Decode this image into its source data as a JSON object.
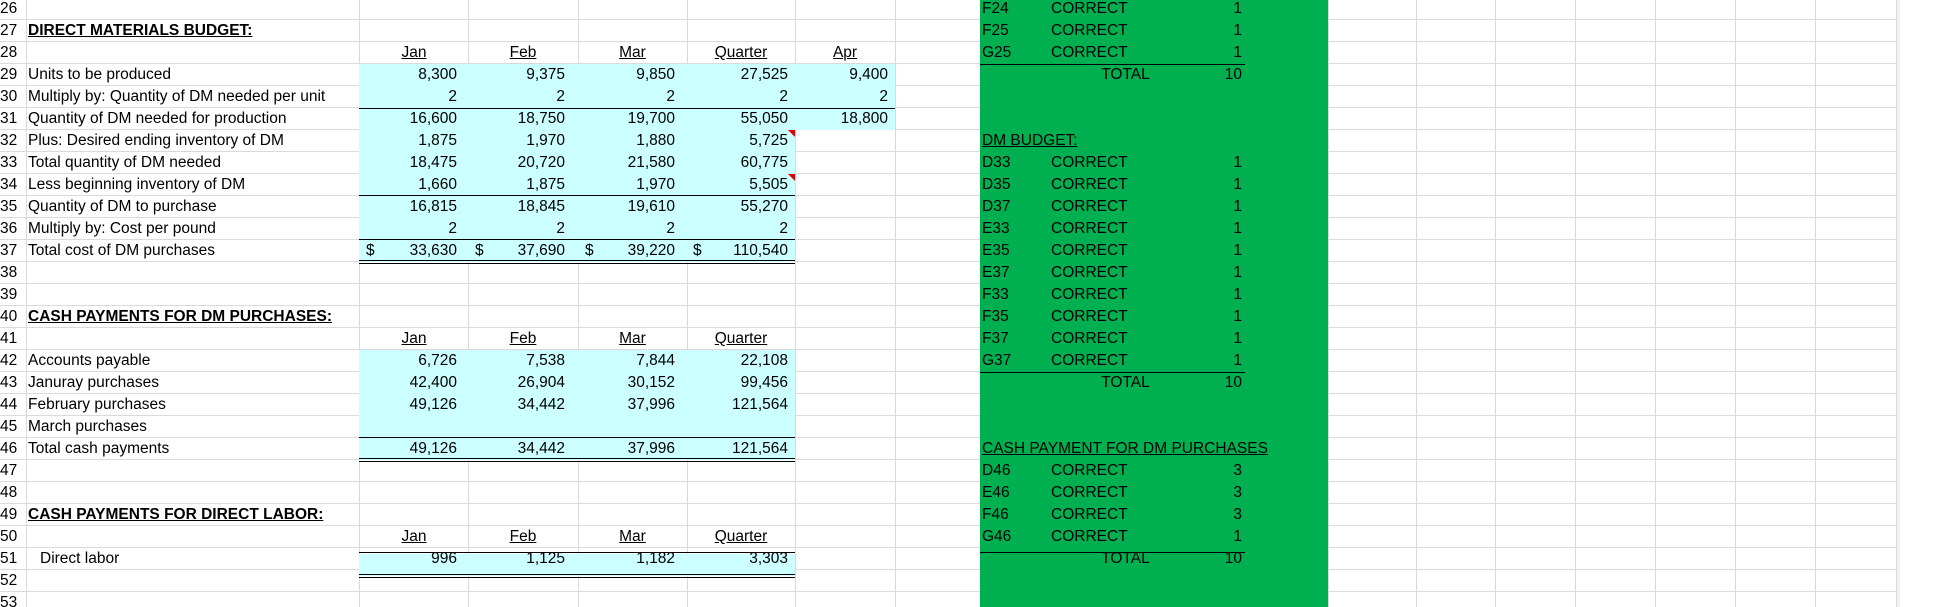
{
  "colors": {
    "cyan_fill": "#ccffff",
    "green_fill": "#00b050",
    "grid": "#dadada"
  },
  "row_numbers": [
    "26",
    "27",
    "28",
    "29",
    "30",
    "31",
    "32",
    "33",
    "34",
    "35",
    "36",
    "37",
    "38",
    "39",
    "40",
    "41",
    "42",
    "43",
    "44",
    "45",
    "46",
    "47",
    "48",
    "49",
    "50",
    "51",
    "52",
    "53"
  ],
  "dm_budget": {
    "title": "DIRECT MATERIALS BUDGET:",
    "headers": [
      "Jan",
      "Feb",
      "Mar",
      "Quarter",
      "Apr"
    ],
    "rows": [
      {
        "label": "Units to be produced",
        "v": [
          "8,300",
          "9,375",
          "9,850",
          "27,525",
          "9,400"
        ]
      },
      {
        "label": "Multiply by: Quantity of DM needed per unit",
        "v": [
          "2",
          "2",
          "2",
          "2",
          "2"
        ]
      },
      {
        "label": "Quantity of DM needed for production",
        "v": [
          "16,600",
          "18,750",
          "19,700",
          "55,050",
          "18,800"
        ]
      },
      {
        "label": "Plus: Desired ending inventory of DM",
        "v": [
          "1,875",
          "1,970",
          "1,880",
          "5,725",
          ""
        ]
      },
      {
        "label": "Total quantity of DM needed",
        "v": [
          "18,475",
          "20,720",
          "21,580",
          "60,775",
          ""
        ]
      },
      {
        "label": "Less beginning inventory of DM",
        "v": [
          "1,660",
          "1,875",
          "1,970",
          "5,505",
          ""
        ]
      },
      {
        "label": "Quantity of DM to purchase",
        "v": [
          "16,815",
          "18,845",
          "19,610",
          "55,270",
          ""
        ]
      },
      {
        "label": "Multiply by: Cost per pound",
        "v": [
          "2",
          "2",
          "2",
          "2",
          ""
        ]
      },
      {
        "label": "Total cost of DM purchases",
        "v": [
          "33,630",
          "37,690",
          "39,220",
          "110,540",
          ""
        ]
      }
    ],
    "currency": "$"
  },
  "cash_dm": {
    "title": "CASH PAYMENTS FOR DM PURCHASES:",
    "headers": [
      "Jan",
      "Feb",
      "Mar",
      "Quarter"
    ],
    "rows": [
      {
        "label": "Accounts payable",
        "v": [
          "6,726",
          "7,538",
          "7,844",
          "22,108"
        ]
      },
      {
        "label": "Januray purchases",
        "v": [
          "42,400",
          "26,904",
          "30,152",
          "99,456"
        ]
      },
      {
        "label": "February purchases",
        "v": [
          "49,126",
          "34,442",
          "37,996",
          "121,564"
        ]
      },
      {
        "label": "March purchases",
        "v": [
          "",
          "",
          "",
          ""
        ]
      },
      {
        "label": "Total cash payments",
        "v": [
          "49,126",
          "34,442",
          "37,996",
          "121,564"
        ]
      }
    ]
  },
  "cash_dl": {
    "title": "CASH PAYMENTS FOR DIRECT LABOR:",
    "headers": [
      "Jan",
      "Feb",
      "Mar",
      "Quarter"
    ],
    "rows": [
      {
        "label": "Direct labor",
        "v": [
          "996",
          "1,125",
          "1,182",
          "3,303"
        ]
      }
    ]
  },
  "grader": {
    "top": [
      {
        "cell": "F24",
        "status": "CORRECT",
        "score": "1"
      },
      {
        "cell": "F25",
        "status": "CORRECT",
        "score": "1"
      },
      {
        "cell": "G25",
        "status": "CORRECT",
        "score": "1"
      }
    ],
    "top_total": {
      "label": "TOTAL",
      "score": "10"
    },
    "dm_title": "DM BUDGET:",
    "dm": [
      {
        "cell": "D33",
        "status": "CORRECT",
        "score": "1"
      },
      {
        "cell": "D35",
        "status": "CORRECT",
        "score": "1"
      },
      {
        "cell": "D37",
        "status": "CORRECT",
        "score": "1"
      },
      {
        "cell": "E33",
        "status": "CORRECT",
        "score": "1"
      },
      {
        "cell": "E35",
        "status": "CORRECT",
        "score": "1"
      },
      {
        "cell": "E37",
        "status": "CORRECT",
        "score": "1"
      },
      {
        "cell": "F33",
        "status": "CORRECT",
        "score": "1"
      },
      {
        "cell": "F35",
        "status": "CORRECT",
        "score": "1"
      },
      {
        "cell": "F37",
        "status": "CORRECT",
        "score": "1"
      },
      {
        "cell": "G37",
        "status": "CORRECT",
        "score": "1"
      }
    ],
    "dm_total": {
      "label": "TOTAL",
      "score": "10"
    },
    "cash_title": "CASH PAYMENT FOR DM PURCHASES",
    "cash": [
      {
        "cell": "D46",
        "status": "CORRECT",
        "score": "3"
      },
      {
        "cell": "E46",
        "status": "CORRECT",
        "score": "3"
      },
      {
        "cell": "F46",
        "status": "CORRECT",
        "score": "3"
      },
      {
        "cell": "G46",
        "status": "CORRECT",
        "score": "1"
      }
    ],
    "cash_total": {
      "label": "TOTAL",
      "score": "10"
    }
  }
}
